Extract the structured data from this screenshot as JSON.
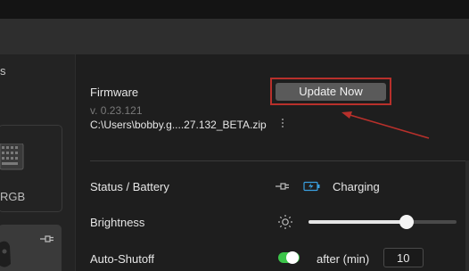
{
  "sidebar": {
    "title_fragment": "s",
    "device_label_fragment": "RGB"
  },
  "firmware": {
    "label": "Firmware",
    "version": "v. 0.23.121",
    "file_path": "C:\\Users\\bobby.g....27.132_BETA.zip",
    "update_button_label": "Update Now"
  },
  "status": {
    "label": "Status / Battery",
    "value": "Charging",
    "icons": [
      "plug-icon",
      "battery-charging-icon"
    ]
  },
  "brightness": {
    "label": "Brightness",
    "level": 0.66,
    "icon": "sun-icon"
  },
  "auto_shutoff": {
    "label": "Auto-Shutoff",
    "enabled": true,
    "unit_label": "after (min)",
    "value": "10"
  },
  "colors": {
    "highlight": "#b8302b",
    "toggle_on": "#3cc54a",
    "battery_accent": "#3aa0e0"
  }
}
